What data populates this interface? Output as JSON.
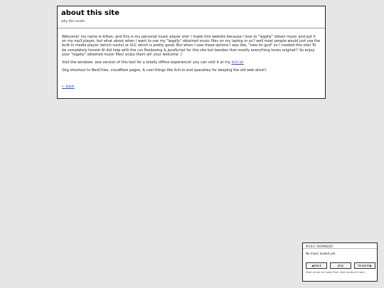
{
  "page": {
    "title": "about this site",
    "subtitle": "why this exists",
    "paragraph1": "Welcome! my name is killian, and this is my personal music player site! I made this website because I love to \"legally\" obtain music and put it on my mp3 player, but what about when I want to use my \"legally\" obtained music files on my laptop or pc? well most people would just use the built in media player (which sucks) or VLC which is pretty good. But when I saw these options I was like, \"naw im gud\" so I created this site! To be completely honest AI did help with the css flexboxing & JavaScript for this site but besides that mostly everything heres original!! So enjoy your \"legally\" obtained music files! enjoy them all! your welcome :)",
    "paragraph2_text": "Visit the windows .exe version of this tool for a totally offline experience! you can visit it at my ",
    "paragraph2_link": "itch.io!",
    "paragraph3": "(big shoutout to NeoCities, cloudflare pages, & cool things like itch.io and spacehey for keeping the old web alive!)",
    "back_link": "← back"
  },
  "reminder": {
    "header": "MUSIC REMINDER",
    "status": "No music loaded yet.",
    "back_label": "◀ back",
    "play_label": "play",
    "forward_label": "forward ▶",
    "note": "Start music on home first, then control it here."
  }
}
